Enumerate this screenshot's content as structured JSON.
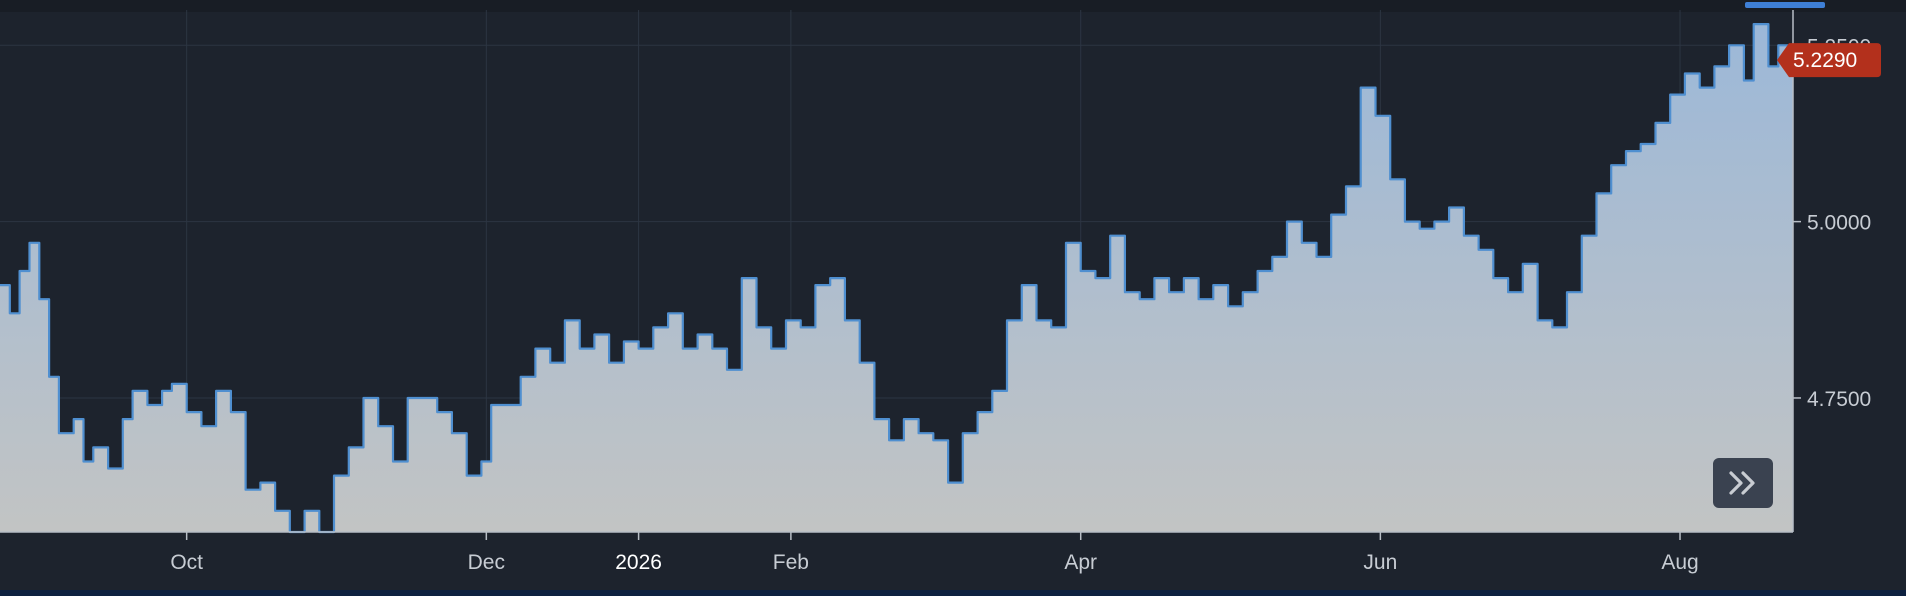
{
  "chart_data": {
    "type": "area",
    "x_start": "2025-08-24",
    "x_end": "2026-08-24",
    "ylim": [
      4.56,
      5.3
    ],
    "y_ticks": [
      "4.7500",
      "5.0000",
      "5.2500"
    ],
    "x_ticks": [
      {
        "label": "Oct",
        "date": "2025-10-01"
      },
      {
        "label": "Dec",
        "date": "2025-12-01"
      },
      {
        "label": "2026",
        "date": "2026-01-01",
        "year": true
      },
      {
        "label": "Feb",
        "date": "2026-02-01"
      },
      {
        "label": "Apr",
        "date": "2026-04-01"
      },
      {
        "label": "Jun",
        "date": "2026-06-01"
      },
      {
        "label": "Aug",
        "date": "2026-08-01"
      }
    ],
    "last_value": "5.2290",
    "points": [
      [
        "2025-08-24",
        4.91
      ],
      [
        "2025-08-26",
        4.87
      ],
      [
        "2025-08-28",
        4.93
      ],
      [
        "2025-08-30",
        4.97
      ],
      [
        "2025-09-01",
        4.89
      ],
      [
        "2025-09-03",
        4.78
      ],
      [
        "2025-09-05",
        4.7
      ],
      [
        "2025-09-08",
        4.72
      ],
      [
        "2025-09-10",
        4.66
      ],
      [
        "2025-09-12",
        4.68
      ],
      [
        "2025-09-15",
        4.65
      ],
      [
        "2025-09-18",
        4.72
      ],
      [
        "2025-09-20",
        4.76
      ],
      [
        "2025-09-23",
        4.74
      ],
      [
        "2025-09-26",
        4.76
      ],
      [
        "2025-09-28",
        4.77
      ],
      [
        "2025-10-01",
        4.73
      ],
      [
        "2025-10-04",
        4.71
      ],
      [
        "2025-10-07",
        4.76
      ],
      [
        "2025-10-10",
        4.73
      ],
      [
        "2025-10-13",
        4.62
      ],
      [
        "2025-10-16",
        4.63
      ],
      [
        "2025-10-19",
        4.59
      ],
      [
        "2025-10-22",
        4.56
      ],
      [
        "2025-10-25",
        4.59
      ],
      [
        "2025-10-28",
        4.56
      ],
      [
        "2025-10-31",
        4.64
      ],
      [
        "2025-11-03",
        4.68
      ],
      [
        "2025-11-06",
        4.75
      ],
      [
        "2025-11-09",
        4.71
      ],
      [
        "2025-11-12",
        4.66
      ],
      [
        "2025-11-15",
        4.75
      ],
      [
        "2025-11-18",
        4.75
      ],
      [
        "2025-11-21",
        4.73
      ],
      [
        "2025-11-24",
        4.7
      ],
      [
        "2025-11-27",
        4.64
      ],
      [
        "2025-11-30",
        4.66
      ],
      [
        "2025-12-02",
        4.74
      ],
      [
        "2025-12-05",
        4.74
      ],
      [
        "2025-12-08",
        4.78
      ],
      [
        "2025-12-11",
        4.82
      ],
      [
        "2025-12-14",
        4.8
      ],
      [
        "2025-12-17",
        4.86
      ],
      [
        "2025-12-20",
        4.82
      ],
      [
        "2025-12-23",
        4.84
      ],
      [
        "2025-12-26",
        4.8
      ],
      [
        "2025-12-29",
        4.83
      ],
      [
        "2026-01-01",
        4.82
      ],
      [
        "2026-01-04",
        4.85
      ],
      [
        "2026-01-07",
        4.87
      ],
      [
        "2026-01-10",
        4.82
      ],
      [
        "2026-01-13",
        4.84
      ],
      [
        "2026-01-16",
        4.82
      ],
      [
        "2026-01-19",
        4.79
      ],
      [
        "2026-01-22",
        4.92
      ],
      [
        "2026-01-25",
        4.85
      ],
      [
        "2026-01-28",
        4.82
      ],
      [
        "2026-01-31",
        4.86
      ],
      [
        "2026-02-03",
        4.85
      ],
      [
        "2026-02-06",
        4.91
      ],
      [
        "2026-02-09",
        4.92
      ],
      [
        "2026-02-12",
        4.86
      ],
      [
        "2026-02-15",
        4.8
      ],
      [
        "2026-02-18",
        4.72
      ],
      [
        "2026-02-21",
        4.69
      ],
      [
        "2026-02-24",
        4.72
      ],
      [
        "2026-02-27",
        4.7
      ],
      [
        "2026-03-02",
        4.69
      ],
      [
        "2026-03-05",
        4.63
      ],
      [
        "2026-03-08",
        4.7
      ],
      [
        "2026-03-11",
        4.73
      ],
      [
        "2026-03-14",
        4.76
      ],
      [
        "2026-03-17",
        4.86
      ],
      [
        "2026-03-20",
        4.91
      ],
      [
        "2026-03-23",
        4.86
      ],
      [
        "2026-03-26",
        4.85
      ],
      [
        "2026-03-29",
        4.97
      ],
      [
        "2026-04-01",
        4.93
      ],
      [
        "2026-04-04",
        4.92
      ],
      [
        "2026-04-07",
        4.98
      ],
      [
        "2026-04-10",
        4.9
      ],
      [
        "2026-04-13",
        4.89
      ],
      [
        "2026-04-16",
        4.92
      ],
      [
        "2026-04-19",
        4.9
      ],
      [
        "2026-04-22",
        4.92
      ],
      [
        "2026-04-25",
        4.89
      ],
      [
        "2026-04-28",
        4.91
      ],
      [
        "2026-05-01",
        4.88
      ],
      [
        "2026-05-04",
        4.9
      ],
      [
        "2026-05-07",
        4.93
      ],
      [
        "2026-05-10",
        4.95
      ],
      [
        "2026-05-13",
        5.0
      ],
      [
        "2026-05-16",
        4.97
      ],
      [
        "2026-05-19",
        4.95
      ],
      [
        "2026-05-22",
        5.01
      ],
      [
        "2026-05-25",
        5.05
      ],
      [
        "2026-05-28",
        5.19
      ],
      [
        "2026-05-31",
        5.15
      ],
      [
        "2026-06-03",
        5.06
      ],
      [
        "2026-06-06",
        5.0
      ],
      [
        "2026-06-09",
        4.99
      ],
      [
        "2026-06-12",
        5.0
      ],
      [
        "2026-06-15",
        5.02
      ],
      [
        "2026-06-18",
        4.98
      ],
      [
        "2026-06-21",
        4.96
      ],
      [
        "2026-06-24",
        4.92
      ],
      [
        "2026-06-27",
        4.9
      ],
      [
        "2026-06-30",
        4.94
      ],
      [
        "2026-07-03",
        4.86
      ],
      [
        "2026-07-06",
        4.85
      ],
      [
        "2026-07-09",
        4.9
      ],
      [
        "2026-07-12",
        4.98
      ],
      [
        "2026-07-15",
        5.04
      ],
      [
        "2026-07-18",
        5.08
      ],
      [
        "2026-07-21",
        5.1
      ],
      [
        "2026-07-24",
        5.11
      ],
      [
        "2026-07-27",
        5.14
      ],
      [
        "2026-07-30",
        5.18
      ],
      [
        "2026-08-02",
        5.21
      ],
      [
        "2026-08-05",
        5.19
      ],
      [
        "2026-08-08",
        5.22
      ],
      [
        "2026-08-11",
        5.25
      ],
      [
        "2026-08-14",
        5.2
      ],
      [
        "2026-08-16",
        5.28
      ],
      [
        "2026-08-19",
        5.22
      ],
      [
        "2026-08-21",
        5.25
      ],
      [
        "2026-08-24",
        5.229
      ]
    ]
  },
  "colors": {
    "background": "#1d232d",
    "line": "#4f8fd0",
    "area_top": "#9cb8d8",
    "area_bottom": "#c2c4c4",
    "price_badge": "#b3301c",
    "accent": "#3e7fd6"
  },
  "controls": {
    "scroll_icon": "double-chevron-right-icon"
  }
}
